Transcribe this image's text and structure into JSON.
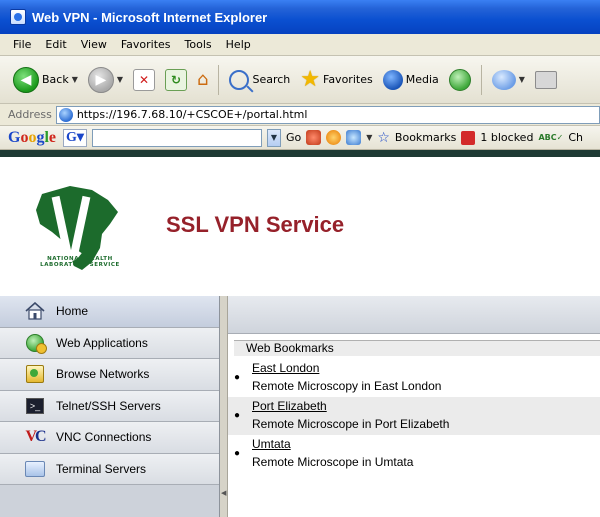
{
  "window": {
    "title": "Web VPN - Microsoft Internet Explorer"
  },
  "menu": {
    "items": [
      "File",
      "Edit",
      "View",
      "Favorites",
      "Tools",
      "Help"
    ]
  },
  "toolbar": {
    "back_label": "Back",
    "search_label": "Search",
    "favorites_label": "Favorites",
    "media_label": "Media"
  },
  "address": {
    "label": "Address",
    "url": "https://196.7.68.10/+CSCOE+/portal.html"
  },
  "google_toolbar": {
    "logo": "Google",
    "g_button": "G",
    "go_label": "Go",
    "bookmarks_label": "Bookmarks",
    "blocked_label": "1 blocked",
    "check_label": "Ch"
  },
  "portal": {
    "title": "SSL VPN Service",
    "logo_caption_line1": "NATIONAL HEALTH",
    "logo_caption_line2": "LABORATORY SERVICE",
    "brand_colors": {
      "title": "#96212a",
      "logo": "#1c6b2c"
    }
  },
  "nav": {
    "items": [
      {
        "label": "Home",
        "icon": "home-icon",
        "active": true
      },
      {
        "label": "Web Applications",
        "icon": "web-applications-icon",
        "active": false
      },
      {
        "label": "Browse Networks",
        "icon": "browse-networks-icon",
        "active": false
      },
      {
        "label": "Telnet/SSH Servers",
        "icon": "terminal-prompt-icon",
        "active": false
      },
      {
        "label": "VNC Connections",
        "icon": "vnc-icon",
        "active": false
      },
      {
        "label": "Terminal Servers",
        "icon": "terminal-servers-icon",
        "active": false
      }
    ]
  },
  "bookmarks": {
    "header": "Web Bookmarks",
    "items": [
      {
        "title": "East London",
        "description": "Remote Microscopy in East London"
      },
      {
        "title": "Port Elizabeth",
        "description": "Remote Microscope in Port Elizabeth"
      },
      {
        "title": "Umtata",
        "description": "Remote Microscope in Umtata"
      }
    ]
  }
}
